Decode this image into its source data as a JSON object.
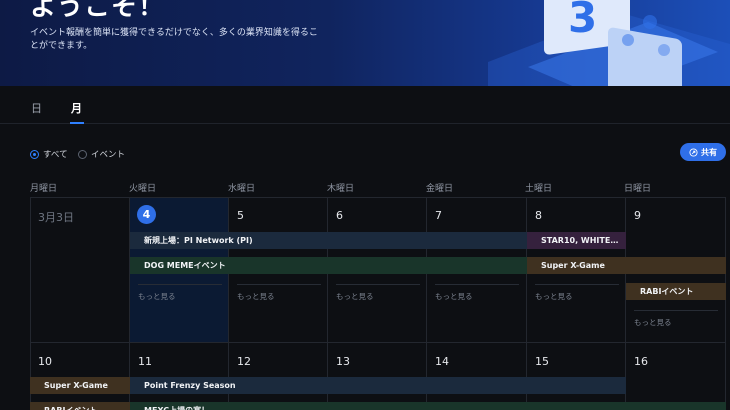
{
  "hero": {
    "title": "ようこそ！",
    "subtitle": "イベント報酬を簡単に獲得できるだけでなく、多くの業界知識を得ることができます。"
  },
  "tabs": [
    {
      "label": "日",
      "active": false
    },
    {
      "label": "月",
      "active": true
    }
  ],
  "filters": [
    {
      "label": "すべて",
      "selected": true
    },
    {
      "label": "イベント",
      "selected": false
    }
  ],
  "share_button": {
    "label": "共有",
    "icon": "share-icon"
  },
  "weekdays": [
    "月曜日",
    "火曜日",
    "水曜日",
    "木曜日",
    "金曜日",
    "土曜日",
    "日曜日"
  ],
  "weeks": [
    {
      "days": [
        "3月3日",
        "4",
        "5",
        "6",
        "7",
        "8",
        "9"
      ]
    },
    {
      "days": [
        "10",
        "11",
        "12",
        "13",
        "14",
        "15",
        "16"
      ]
    }
  ],
  "today": "4",
  "events": {
    "pi_network": "新規上場：PI Network (PI)",
    "star10": "STAR10, WHITE…",
    "dog_meme": "DOG MEMEイベント",
    "super_x_game": "Super X-Game",
    "rabi": "RABIイベント",
    "super_x_game_w2": "Super X-Game",
    "point_frenzy": "Point Frenzy Season",
    "rabi_w2": "RABIイベント",
    "mexc": "MEXC上場の宴！"
  },
  "more_label": "もっと見る",
  "colors": {
    "accent": "#2f6fe8",
    "event_blue": "#1b2a3d",
    "event_green": "#19352a",
    "event_brown": "#3f3120",
    "event_purple": "#35213d"
  }
}
